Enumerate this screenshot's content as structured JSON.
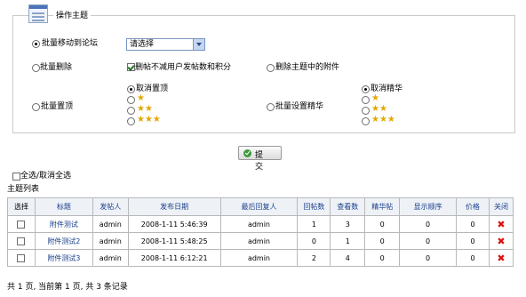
{
  "section_title": "操作主题",
  "options": {
    "batch_move_label": "批量移动到论坛",
    "forum_select": {
      "value": "请选择"
    },
    "batch_delete_label": "批量删除",
    "keep_points_label": "删帖不减用户发帖数和积分",
    "delete_attachments_label": "删除主题中的附件",
    "batch_sticky_label": "批量置顶",
    "cancel_sticky_label": "取消置顶",
    "batch_digest_label": "批量设置精华",
    "cancel_digest_label": "取消精华",
    "star_levels": [
      "★",
      "★★",
      "★★★"
    ]
  },
  "submit_label": "提 交",
  "select_all_label": "全选/取消全选",
  "list_title": "主题列表",
  "table": {
    "headers": [
      "选择",
      "标题",
      "发帖人",
      "发布日期",
      "最后回复人",
      "回帖数",
      "查看数",
      "精华帖",
      "显示顺序",
      "价格",
      "关闭"
    ],
    "rows": [
      {
        "title": "附件测试",
        "author": "admin",
        "date": "2008-1-11 5:46:39",
        "last_reply": "admin",
        "replies": "1",
        "views": "3",
        "digest": "0",
        "order": "0",
        "price": "0"
      },
      {
        "title": "附件测试2",
        "author": "admin",
        "date": "2008-1-11 5:48:25",
        "last_reply": "admin",
        "replies": "0",
        "views": "1",
        "digest": "0",
        "order": "0",
        "price": "0"
      },
      {
        "title": "附件测试3",
        "author": "admin",
        "date": "2008-1-11 6:12:21",
        "last_reply": "admin",
        "replies": "2",
        "views": "4",
        "digest": "0",
        "order": "0",
        "price": "0"
      }
    ]
  },
  "footer": "共 1 页, 当前第 1 页, 共 3 条记录",
  "colors": {
    "header_text": "#1b3f8b",
    "border": "#b8b8b8",
    "delete": "#dd1111",
    "star": "#e0a800"
  }
}
